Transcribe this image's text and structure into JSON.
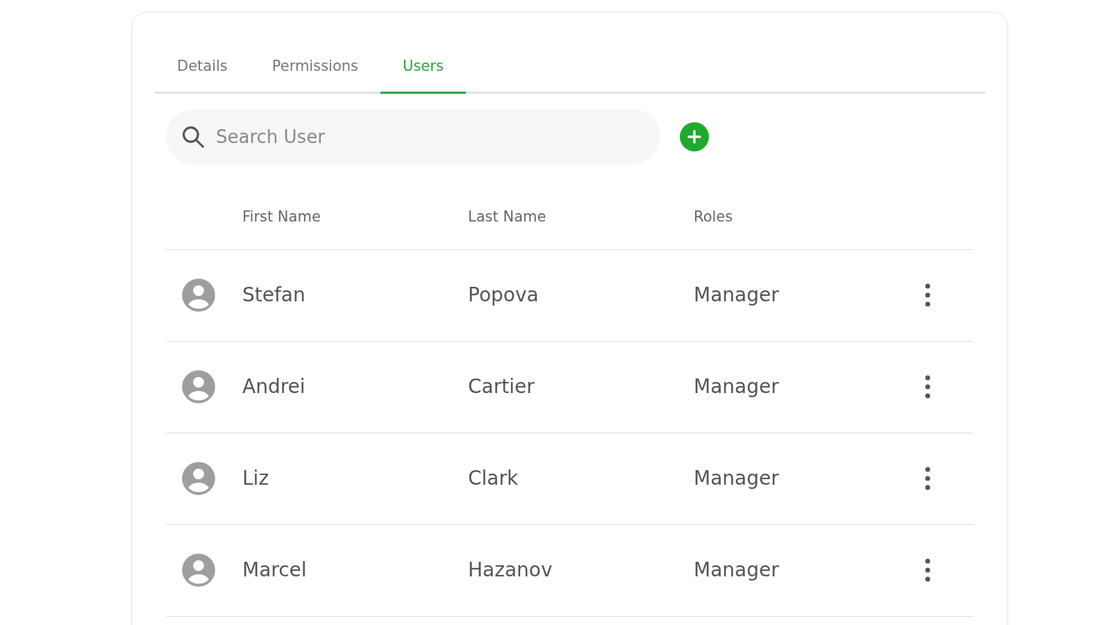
{
  "tabs": [
    {
      "label": "Details",
      "selected": false
    },
    {
      "label": "Permissions",
      "selected": false
    },
    {
      "label": "Users",
      "selected": true
    }
  ],
  "search": {
    "placeholder": "Search User"
  },
  "table": {
    "columns": [
      "First Name",
      "Last Name",
      "Roles"
    ],
    "rows": [
      {
        "first_name": "Stefan",
        "last_name": "Popova",
        "role": "Manager"
      },
      {
        "first_name": "Andrei",
        "last_name": "Cartier",
        "role": "Manager"
      },
      {
        "first_name": "Liz",
        "last_name": "Clark",
        "role": "Manager"
      },
      {
        "first_name": "Marcel",
        "last_name": "Hazanov",
        "role": "Manager"
      }
    ]
  }
}
